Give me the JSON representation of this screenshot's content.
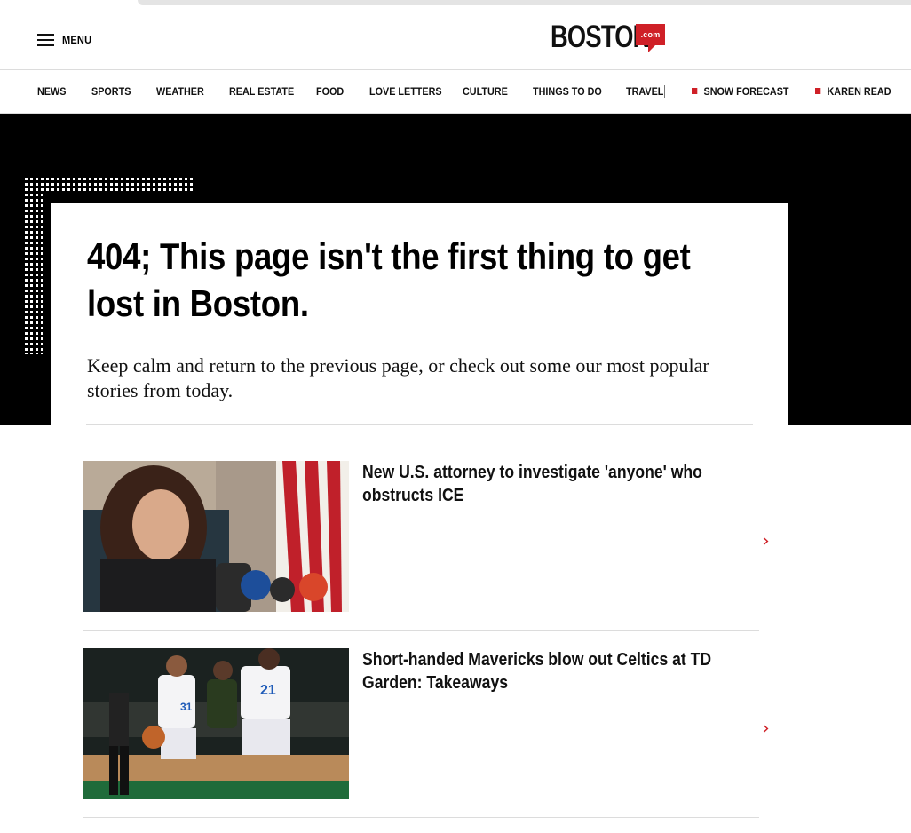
{
  "header": {
    "menu_label": "MENU",
    "logo": {
      "word": "BOSTON",
      "suffix": ".com",
      "accent_color": "#cf2027"
    }
  },
  "nav": {
    "items": [
      "NEWS",
      "SPORTS",
      "WEATHER",
      "REAL ESTATE",
      "FOOD",
      "LOVE LETTERS",
      "CULTURE",
      "THINGS TO DO",
      "TRAVEL"
    ],
    "trending": [
      "SNOW FORECAST",
      "KAREN READ"
    ]
  },
  "hero": {
    "title": "404; This page isn't the first thing to get lost in Boston.",
    "lede": "Keep calm and return to the previous page, or check out some our most popular stories from today."
  },
  "stories": [
    {
      "headline": "New U.S. attorney to investigate 'anyone' who obstructs ICE",
      "icon": "chevron-right-icon"
    },
    {
      "headline": "Short-handed Mavericks blow out Celtics at TD Garden: Takeaways",
      "icon": "chevron-right-icon"
    }
  ],
  "colors": {
    "accent": "#cf2027",
    "hero_background": "#000000",
    "text": "#111111"
  }
}
